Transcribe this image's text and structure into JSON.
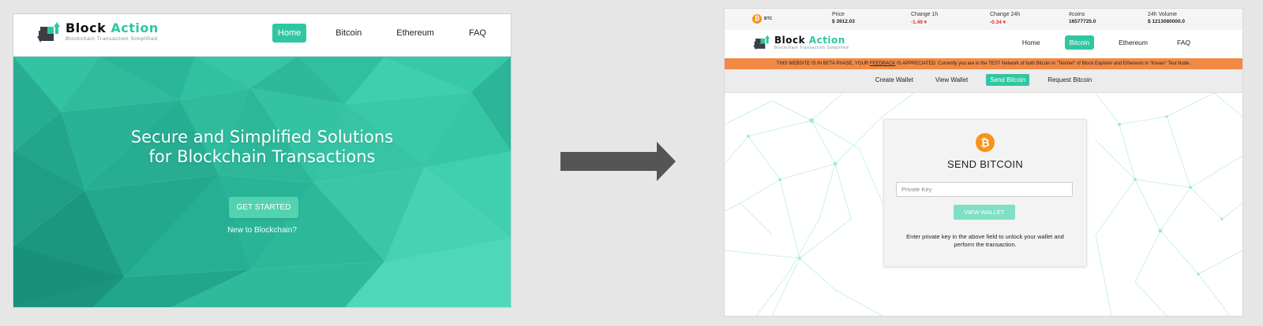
{
  "left_screen": {
    "logo": {
      "name_part1": "Block",
      "name_part2": "Action",
      "tagline": "Blockchain Transaction Simplified"
    },
    "nav": [
      {
        "label": "Home",
        "active": true
      },
      {
        "label": "Bitcoin",
        "active": false
      },
      {
        "label": "Ethereum",
        "active": false
      },
      {
        "label": "FAQ",
        "active": false
      }
    ],
    "hero": {
      "title_line1": "Secure and Simplified Solutions",
      "title_line2": "for Blockchain Transactions",
      "button": "GET STARTED",
      "subtext": "New to Blockchain?"
    }
  },
  "transition_arrow": {
    "icon": "right-arrow-icon",
    "color": "#555555"
  },
  "right_screen": {
    "ticker": {
      "coin_icon": "bitcoin-icon",
      "coin_symbol": "BTC",
      "columns": [
        {
          "label": "Price",
          "value": "$ 3912.03",
          "negative": false
        },
        {
          "label": "Change 1h",
          "value": "-1.49 ▾",
          "negative": true
        },
        {
          "label": "Change 24h",
          "value": "-0.34 ▾",
          "negative": true
        },
        {
          "label": "#coins",
          "value": "16577725.0",
          "negative": false
        },
        {
          "label": "24h Volume",
          "value": "$ 1213080000.0",
          "negative": false
        }
      ]
    },
    "logo": {
      "name_part1": "Block",
      "name_part2": "Action",
      "tagline": "Blockchain Transaction Simplified"
    },
    "nav": [
      {
        "label": "Home",
        "active": false
      },
      {
        "label": "Bitcoin",
        "active": true
      },
      {
        "label": "Ethereum",
        "active": false
      },
      {
        "label": "FAQ",
        "active": false
      }
    ],
    "beta_banner": {
      "before": "THIS WEBSITE IS IN BETA PHASE, YOUR ",
      "link": "FEEDBACK",
      "after": " IS APPRECIATED. Currently you are in the TEST Network of both Bitcoin in \"Testnet\" of Block Explorer and Ethereum in \"Kovan\" Test Node."
    },
    "subnav": [
      {
        "label": "Create Wallet",
        "active": false
      },
      {
        "label": "View Wallet",
        "active": false
      },
      {
        "label": "Send Bitcoin",
        "active": true
      },
      {
        "label": "Request Bitcoin",
        "active": false
      }
    ],
    "card": {
      "icon": "bitcoin-icon",
      "title": "SEND BITCOIN",
      "input_placeholder": "Private Key",
      "input_value": "",
      "button": "VIEW WALLET",
      "help_text": "Enter private key in the above field to unlock your wallet and perform the transaction."
    }
  },
  "colors": {
    "accent": "#2fc7a1",
    "hero_bg": "#2bb99a",
    "bitcoin": "#f7931a",
    "beta_banner": "#f28a45",
    "negative": "#e02d2d"
  }
}
